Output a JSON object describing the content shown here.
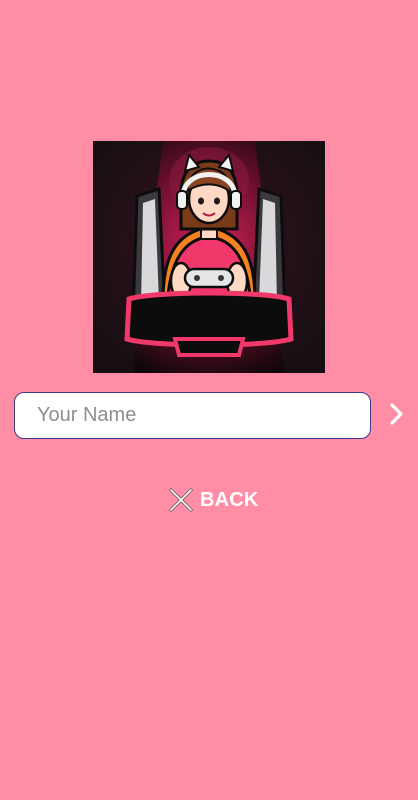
{
  "logo": {
    "icon": "gamer-girl-mascot-logo"
  },
  "name_input": {
    "placeholder": "Your Name",
    "value": ""
  },
  "next_button": {
    "icon": "chevron-right-icon"
  },
  "back_button": {
    "label": "BACK",
    "icon": "close-icon"
  },
  "colors": {
    "background": "#FF8DA6",
    "input_border": "#3b3a8a",
    "text_on_bg": "#FFFFFF",
    "placeholder": "#8e8e8e"
  }
}
